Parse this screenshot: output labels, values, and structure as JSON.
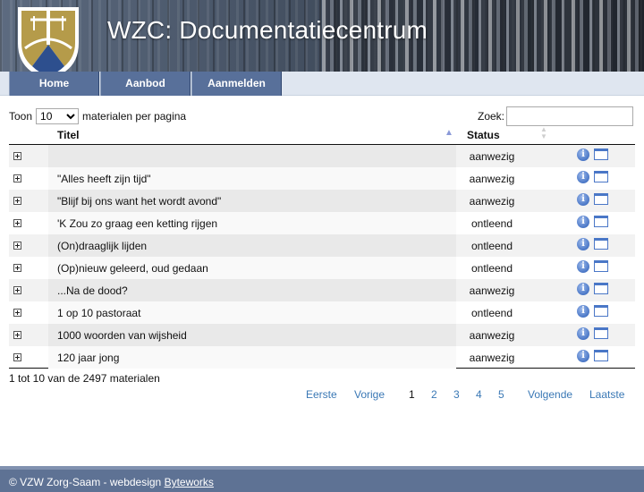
{
  "header": {
    "title": "WZC: Documentatiecentrum"
  },
  "nav": {
    "items": [
      "Home",
      "Aanbod",
      "Aanmelden"
    ]
  },
  "controls": {
    "show_label": "Toon",
    "page_size": "10",
    "page_size_suffix": "materialen per pagina",
    "search_label": "Zoek:",
    "search_value": ""
  },
  "table": {
    "columns": [
      "Titel",
      "Status"
    ],
    "rows": [
      {
        "titel": "",
        "status": "aanwezig"
      },
      {
        "titel": "\"Alles heeft zijn tijd\"",
        "status": "aanwezig"
      },
      {
        "titel": "\"Blijf bij ons want het wordt avond\"",
        "status": "aanwezig"
      },
      {
        "titel": "'K Zou zo graag een ketting rijgen",
        "status": "ontleend"
      },
      {
        "titel": "(On)draaglijk lijden",
        "status": "ontleend"
      },
      {
        "titel": "(Op)nieuw geleerd, oud gedaan",
        "status": "ontleend"
      },
      {
        "titel": "...Na de dood?",
        "status": "aanwezig"
      },
      {
        "titel": "1 op 10 pastoraat",
        "status": "ontleend"
      },
      {
        "titel": "1000 woorden van wijsheid",
        "status": "aanwezig"
      },
      {
        "titel": "120 jaar jong",
        "status": "aanwezig"
      }
    ]
  },
  "info": "1 tot 10 van de 2497 materialen",
  "pagination": {
    "first": "Eerste",
    "previous": "Vorige",
    "pages": [
      "1",
      "2",
      "3",
      "4",
      "5"
    ],
    "current": "1",
    "next": "Volgende",
    "last": "Laatste"
  },
  "footer": {
    "text": "© VZW Zorg-Saam - webdesign",
    "link": "Byteworks"
  },
  "colors": {
    "nav_bg": "#58709a",
    "footer_bg": "#5e7294",
    "link": "#3a78b5",
    "icon_blue": "#4a77c7"
  }
}
